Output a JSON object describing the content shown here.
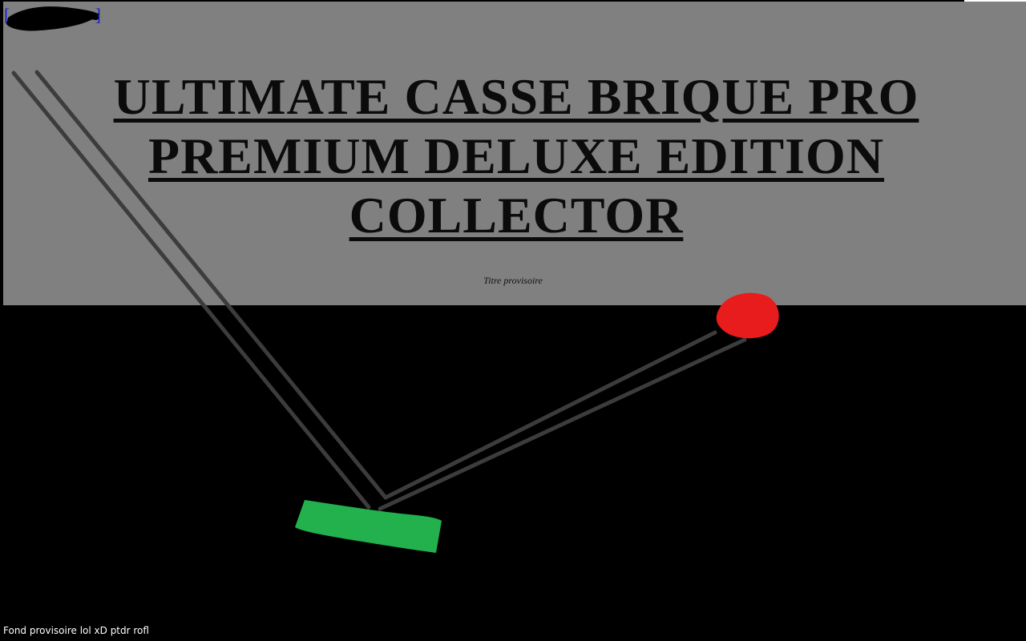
{
  "header": {
    "link_brackets": [
      "[",
      "]"
    ],
    "title": "ULTIMATE CASSE BRIQUE PRO PREMIUM DELUXE EDITION COLLECTOR",
    "subtitle": "Titre provisoire"
  },
  "game": {
    "ball": {
      "color": "#e81c1c"
    },
    "paddle": {
      "color": "#22b14c"
    },
    "trajectory": {
      "color": "#3c3c3c"
    }
  },
  "footer": {
    "note": "Fond provisoire lol xD ptdr rofl"
  },
  "colors": {
    "panel": "#808080",
    "background": "#000000",
    "link": "#1a1acc",
    "scribble": "#000000"
  }
}
